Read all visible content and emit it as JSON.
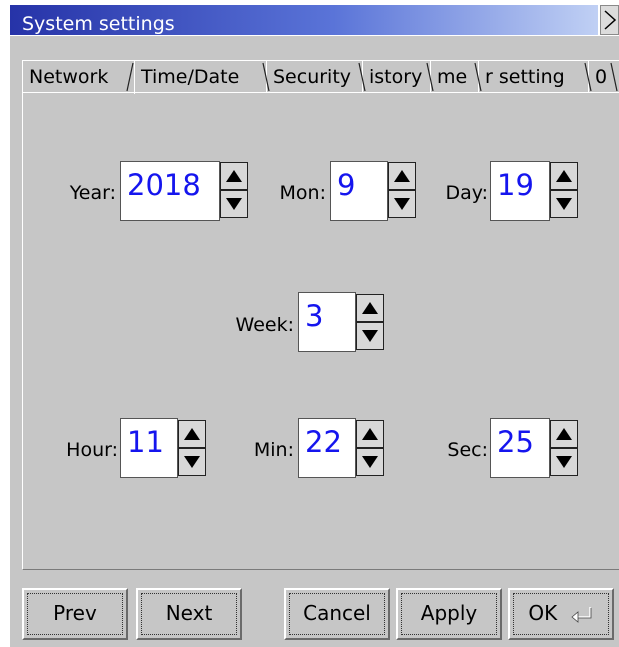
{
  "window": {
    "title": "System settings"
  },
  "tabs": [
    {
      "label": "Network"
    },
    {
      "label": "Time/Date"
    },
    {
      "label": "Security"
    },
    {
      "label": "istory"
    },
    {
      "label": "me"
    },
    {
      "label": "r setting"
    },
    {
      "label": "0"
    }
  ],
  "fields": {
    "year": {
      "label": "Year:",
      "value": "2018"
    },
    "mon": {
      "label": "Mon:",
      "value": "9"
    },
    "day": {
      "label": "Day:",
      "value": "19"
    },
    "week": {
      "label": "Week:",
      "value": "3"
    },
    "hour": {
      "label": "Hour:",
      "value": "11"
    },
    "min": {
      "label": "Min:",
      "value": "22"
    },
    "sec": {
      "label": "Sec:",
      "value": "25"
    }
  },
  "buttons": {
    "prev": "Prev",
    "next": "Next",
    "cancel": "Cancel",
    "apply": "Apply",
    "ok": "OK"
  },
  "colors": {
    "field_text": "#1515ee",
    "title_bar": "#2633a8"
  },
  "icons": {
    "close": "chevron-right-icon",
    "enter": "enter-icon",
    "spin_up": "arrow-up-icon",
    "spin_down": "arrow-down-icon"
  }
}
